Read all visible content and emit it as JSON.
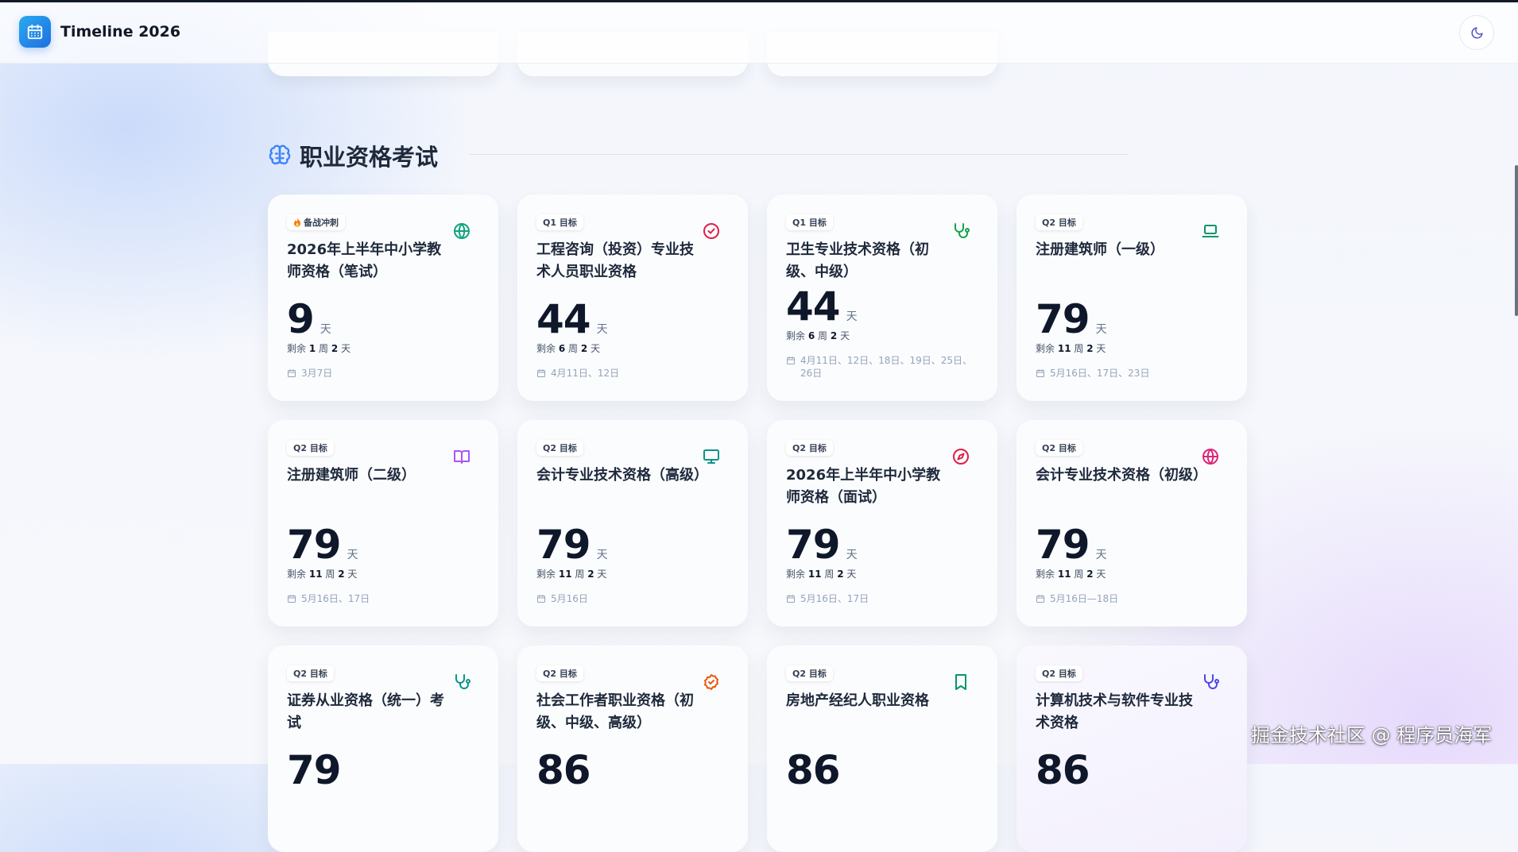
{
  "app": {
    "title": "Timeline 2026"
  },
  "section": {
    "title": "职业资格考试"
  },
  "watermark": "掘金技术社区 @ 程序员海军",
  "cards": [
    {
      "badge": "备战冲刺",
      "badge_flame": true,
      "title": "2026年上半年中小学教师资格（笔试）",
      "days": "9",
      "unit": "天",
      "remain_prefix": "剩余",
      "weeks": "1",
      "week_unit": "周",
      "rem_days": "2",
      "day_unit": "天",
      "dates": "3月7日",
      "icon": "globe-icon",
      "color": "#10a37f"
    },
    {
      "badge": "Q1 目标",
      "title": "工程咨询（投资）专业技术人员职业资格",
      "days": "44",
      "unit": "天",
      "remain_prefix": "剩余",
      "weeks": "6",
      "week_unit": "周",
      "rem_days": "2",
      "day_unit": "天",
      "dates": "4月11日、12日",
      "icon": "check-circle-icon",
      "color": "#e11d48"
    },
    {
      "badge": "Q1 目标",
      "title": "卫生专业技术资格（初级、中级）",
      "days": "44",
      "unit": "天",
      "remain_prefix": "剩余",
      "weeks": "6",
      "week_unit": "周",
      "rem_days": "2",
      "day_unit": "天",
      "dates": "4月11日、12日、18日、19日、25日、26日",
      "icon": "stethoscope-icon",
      "color": "#16a34a"
    },
    {
      "badge": "Q2 目标",
      "title": "注册建筑师（一级）",
      "days": "79",
      "unit": "天",
      "remain_prefix": "剩余",
      "weeks": "11",
      "week_unit": "周",
      "rem_days": "2",
      "day_unit": "天",
      "dates": "5月16日、17日、23日",
      "icon": "laptop-icon",
      "color": "#059669"
    },
    {
      "badge": "Q2 目标",
      "title": "注册建筑师（二级）",
      "days": "79",
      "unit": "天",
      "remain_prefix": "剩余",
      "weeks": "11",
      "week_unit": "周",
      "rem_days": "2",
      "day_unit": "天",
      "dates": "5月16日、17日",
      "icon": "book-open-icon",
      "color": "#a855f7"
    },
    {
      "badge": "Q2 目标",
      "title": "会计专业技术资格（高级）",
      "days": "79",
      "unit": "天",
      "remain_prefix": "剩余",
      "weeks": "11",
      "week_unit": "周",
      "rem_days": "2",
      "day_unit": "天",
      "dates": "5月16日",
      "icon": "monitor-icon",
      "color": "#0d9488"
    },
    {
      "badge": "Q2 目标",
      "title": "2026年上半年中小学教师资格（面试）",
      "days": "79",
      "unit": "天",
      "remain_prefix": "剩余",
      "weeks": "11",
      "week_unit": "周",
      "rem_days": "2",
      "day_unit": "天",
      "dates": "5月16日、17日",
      "icon": "compass-icon",
      "color": "#e11d48"
    },
    {
      "badge": "Q2 目标",
      "title": "会计专业技术资格（初级）",
      "days": "79",
      "unit": "天",
      "remain_prefix": "剩余",
      "weeks": "11",
      "week_unit": "周",
      "rem_days": "2",
      "day_unit": "天",
      "dates": "5月16日—18日",
      "icon": "globe-icon",
      "color": "#db2777"
    },
    {
      "badge": "Q2 目标",
      "title": "证券从业资格（统一）考试",
      "days": "79",
      "icon": "stethoscope-icon",
      "color": "#0d9488"
    },
    {
      "badge": "Q2 目标",
      "title": "社会工作者职业资格（初级、中级、高级）",
      "days": "86",
      "icon": "check-badge-icon",
      "color": "#ea580c"
    },
    {
      "badge": "Q2 目标",
      "title": "房地产经纪人职业资格",
      "days": "86",
      "icon": "bookmark-icon",
      "color": "#059669"
    },
    {
      "badge": "Q2 目标",
      "title": "计算机技术与软件专业技术资格",
      "days": "86",
      "icon": "stethoscope-icon",
      "color": "#4f46e5"
    }
  ]
}
